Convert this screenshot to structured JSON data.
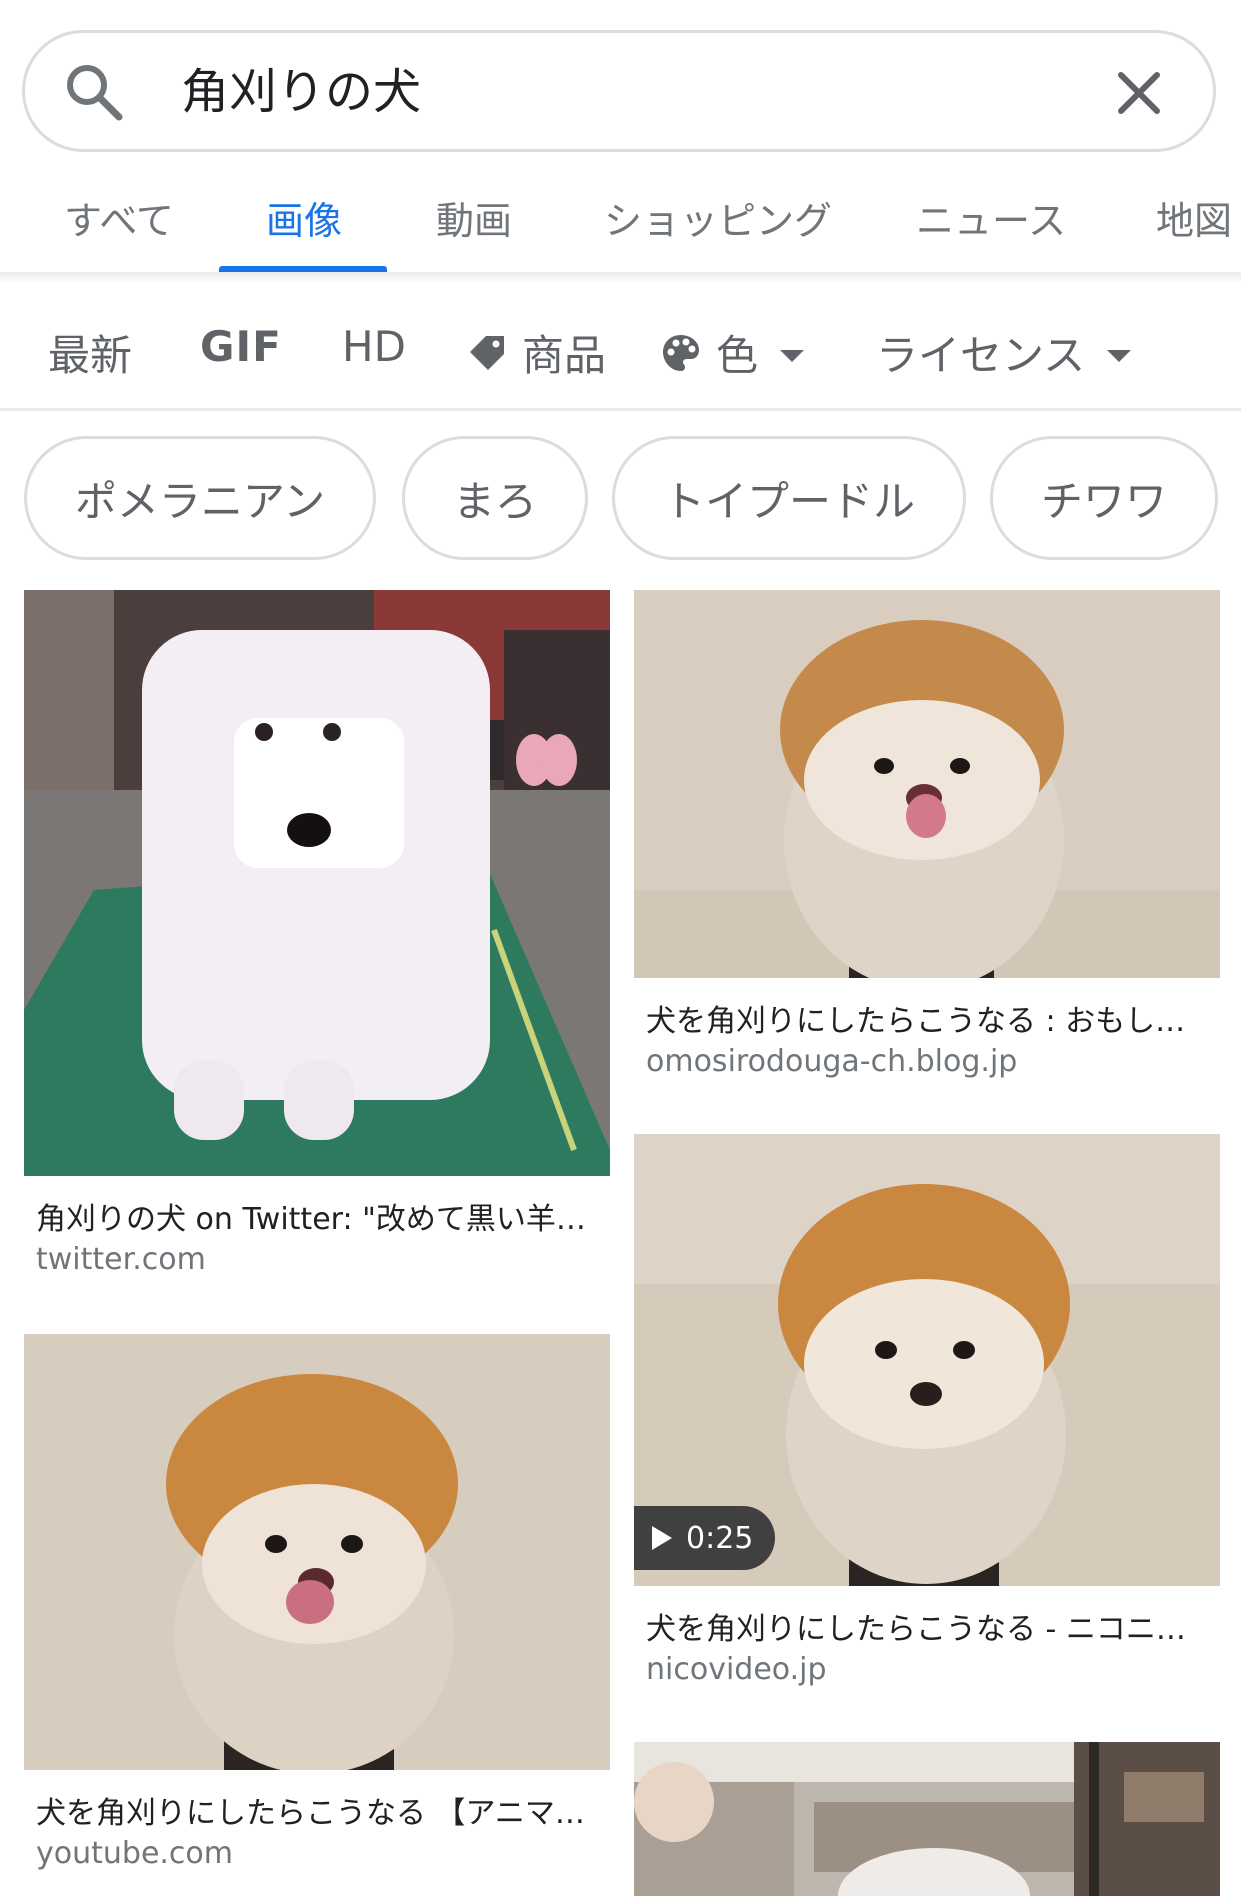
{
  "search": {
    "query": "角刈りの犬"
  },
  "tabs": [
    {
      "label": "すべて"
    },
    {
      "label": "画像"
    },
    {
      "label": "動画"
    },
    {
      "label": "ショッピング"
    },
    {
      "label": "ニュース"
    },
    {
      "label": "地図"
    }
  ],
  "active_tab": "画像",
  "filters": {
    "latest": "最新",
    "gif": "GIF",
    "hd": "HD",
    "product": "商品",
    "color": "色",
    "license": "ライセンス"
  },
  "chips": [
    {
      "label": "ポメラニアン"
    },
    {
      "label": "まろ"
    },
    {
      "label": "トイプードル"
    },
    {
      "label": "チワワ"
    }
  ],
  "results": [
    {
      "title": "角刈りの犬 on Twitter: \"改めて黒い羊見…",
      "source": "twitter.com"
    },
    {
      "title": "犬を角刈りにしたらこうなる : おもし…",
      "source": "omosirodouga-ch.blog.jp"
    },
    {
      "title": "犬を角刈りにしたらこうなる - ニコニ…",
      "source": "nicovideo.jp",
      "video_duration": "0:25"
    },
    {
      "title": "犬を角刈りにしたらこうなる 【アニマ…",
      "source": "youtube.com"
    }
  ],
  "colors": {
    "accent": "#1a73e8",
    "text_secondary": "#70757a",
    "border": "#dadce0"
  }
}
